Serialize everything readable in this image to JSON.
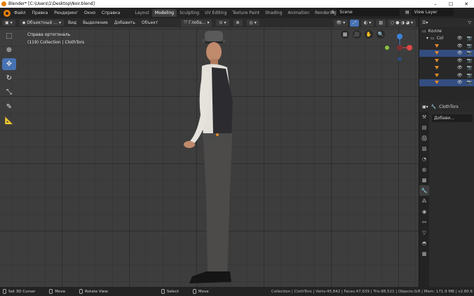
{
  "window": {
    "title": "Blender* [C:\\Users\\1\\Desktop\\Noir.blend]",
    "controls": [
      "–",
      "☐",
      "✕"
    ]
  },
  "menu": [
    "Файл",
    "Правка",
    "Рендеринг",
    "Окно",
    "Справка"
  ],
  "workspaces": [
    "Layout",
    "Modeling",
    "Sculpting",
    "UV Editing",
    "Texture Paint",
    "Shading",
    "Animation",
    "Rendering"
  ],
  "active_workspace": "Modeling",
  "scene": {
    "label": "Scene"
  },
  "view_layer": {
    "label": "View Layer"
  },
  "viewport_header": {
    "mode": "Объектный ...",
    "menus": [
      "Вид",
      "Выделение",
      "Добавить",
      "Объект"
    ],
    "orientation": "Глоба..."
  },
  "viewport": {
    "view_name": "Справа ортогональ",
    "collection_info": "(119) Collection | ClothTors"
  },
  "outliner": {
    "root": "Колле",
    "collection": "Col"
  },
  "properties": {
    "object": "ClothTors",
    "add_modifier": "Добави..."
  },
  "statusbar": {
    "items": [
      "Set 3D Cursor",
      "Move",
      "Rotate View",
      "Select",
      "Move"
    ],
    "stats": "Collection | ClothTors | Verts:45,842 | Faces:47,639 | Tris:88,521 | Objects:0/8 | Mem: 171.9 MB | v2.80.6"
  },
  "colors": {
    "accent": "#4772b3",
    "header": "#232323",
    "viewport_bg": "#3d3d3d",
    "gizmo_x": "#e04848",
    "gizmo_y": "#8ac43b",
    "gizmo_z": "#3d83d9",
    "object_origin": "#e28a2b"
  }
}
